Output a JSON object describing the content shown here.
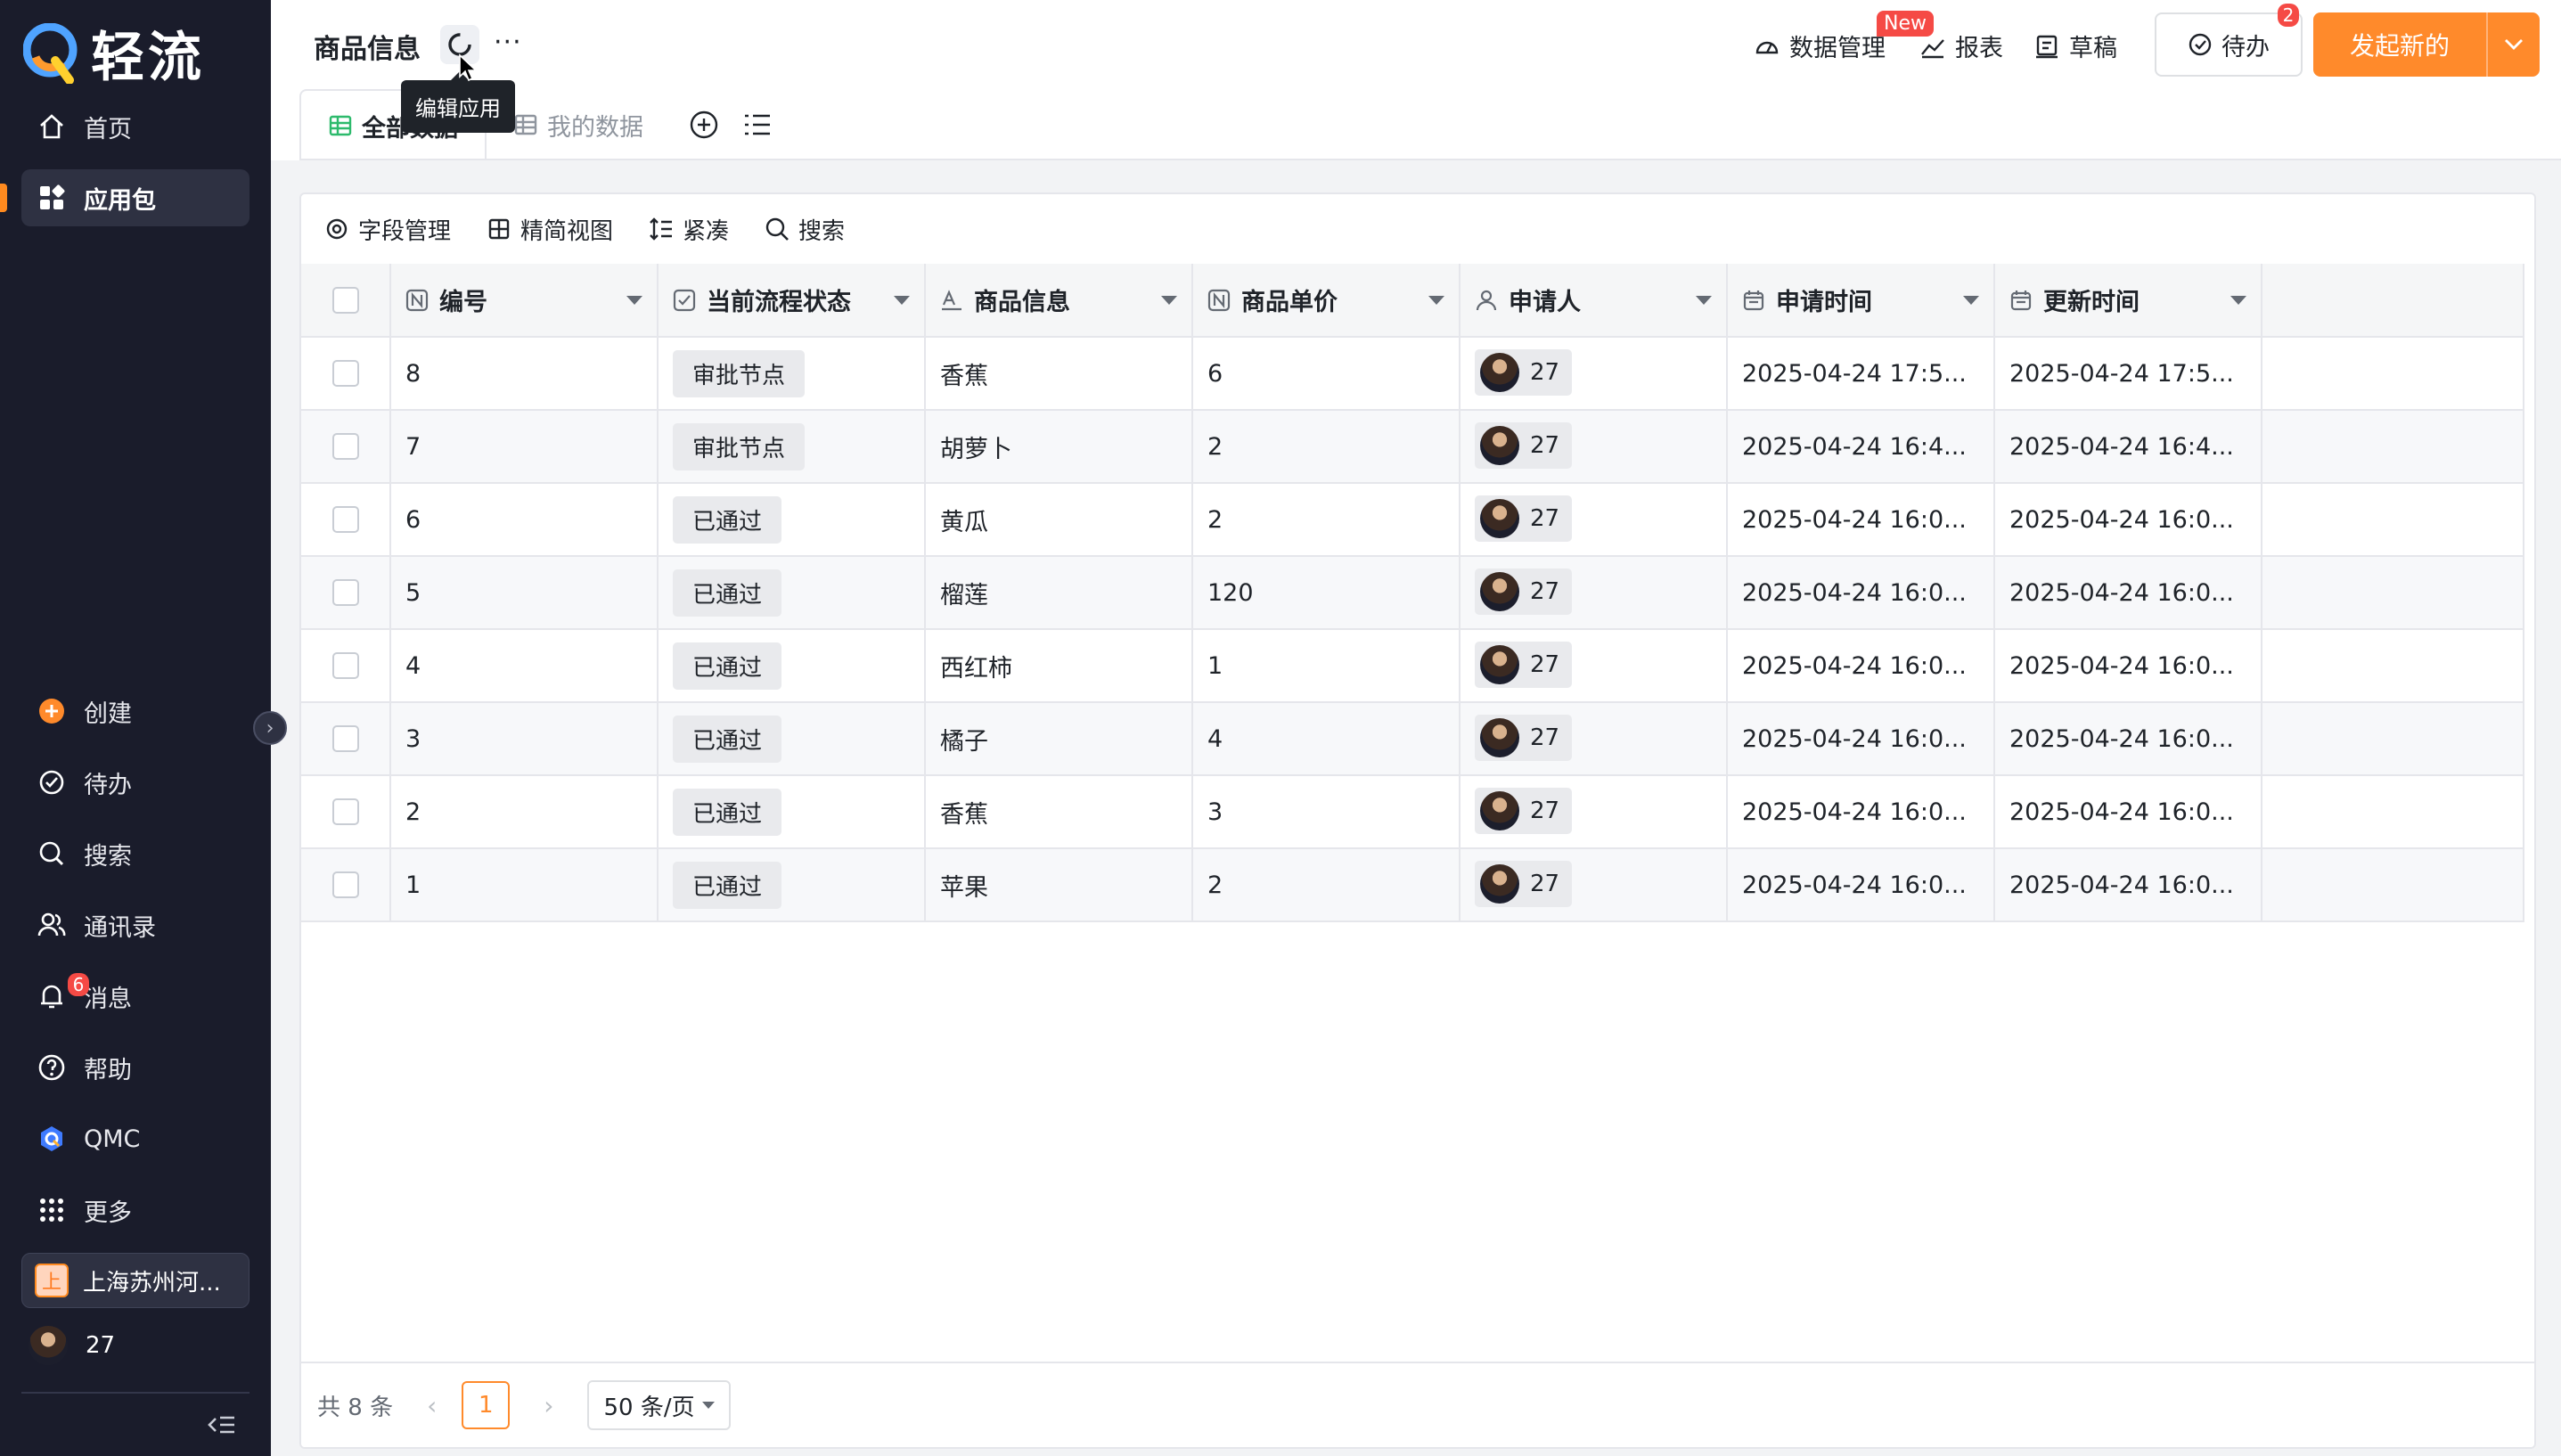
{
  "colors": {
    "sidebar_bg": "#1a1c2b",
    "accent": "#ff8a2b",
    "badge": "#f54a45"
  },
  "app": {
    "brand": "轻流"
  },
  "sidebar": {
    "top_items": [
      {
        "label": "首页",
        "icon": "home-icon"
      },
      {
        "label": "应用包",
        "icon": "apps-icon",
        "active": true
      }
    ],
    "bottom_items": [
      {
        "label": "创建",
        "icon": "plus-circle-icon"
      },
      {
        "label": "待办",
        "icon": "check-circle-icon"
      },
      {
        "label": "搜索",
        "icon": "search-icon"
      },
      {
        "label": "通讯录",
        "icon": "contacts-icon"
      },
      {
        "label": "消息",
        "icon": "bell-icon",
        "badge": "6"
      },
      {
        "label": "帮助",
        "icon": "help-icon"
      },
      {
        "label": "QMC",
        "icon": "qmc-icon"
      },
      {
        "label": "更多",
        "icon": "grid-icon"
      }
    ],
    "org": {
      "initial": "上",
      "name": "上海苏州河..."
    },
    "user": {
      "name": "27"
    }
  },
  "header": {
    "title": "商品信息",
    "tooltip": "编辑应用",
    "more": "···",
    "links": {
      "data_manage": "数据管理",
      "new_badge": "New",
      "report": "报表",
      "draft": "草稿"
    },
    "todo": {
      "label": "待办",
      "badge": "2"
    },
    "start_button": "发起新的",
    "tabs": [
      {
        "label": "全部数据",
        "active": true
      },
      {
        "label": "我的数据",
        "active": false
      }
    ]
  },
  "toolbar": {
    "fields": "字段管理",
    "simple_view": "精简视图",
    "compact": "紧凑",
    "search": "搜索"
  },
  "table": {
    "columns": [
      "编号",
      "当前流程状态",
      "商品信息",
      "商品单价",
      "申请人",
      "申请时间",
      "更新时间"
    ],
    "rows": [
      {
        "id": "8",
        "status": "审批节点",
        "product": "香蕉",
        "price": "6",
        "applicant": "27",
        "applied": "2025-04-24 17:5...",
        "updated": "2025-04-24 17:5..."
      },
      {
        "id": "7",
        "status": "审批节点",
        "product": "胡萝卜",
        "price": "2",
        "applicant": "27",
        "applied": "2025-04-24 16:4...",
        "updated": "2025-04-24 16:4..."
      },
      {
        "id": "6",
        "status": "已通过",
        "product": "黄瓜",
        "price": "2",
        "applicant": "27",
        "applied": "2025-04-24 16:0...",
        "updated": "2025-04-24 16:0..."
      },
      {
        "id": "5",
        "status": "已通过",
        "product": "榴莲",
        "price": "120",
        "applicant": "27",
        "applied": "2025-04-24 16:0...",
        "updated": "2025-04-24 16:0..."
      },
      {
        "id": "4",
        "status": "已通过",
        "product": "西红柿",
        "price": "1",
        "applicant": "27",
        "applied": "2025-04-24 16:0...",
        "updated": "2025-04-24 16:0..."
      },
      {
        "id": "3",
        "status": "已通过",
        "product": "橘子",
        "price": "4",
        "applicant": "27",
        "applied": "2025-04-24 16:0...",
        "updated": "2025-04-24 16:0..."
      },
      {
        "id": "2",
        "status": "已通过",
        "product": "香蕉",
        "price": "3",
        "applicant": "27",
        "applied": "2025-04-24 16:0...",
        "updated": "2025-04-24 16:0..."
      },
      {
        "id": "1",
        "status": "已通过",
        "product": "苹果",
        "price": "2",
        "applicant": "27",
        "applied": "2025-04-24 16:0...",
        "updated": "2025-04-24 16:0..."
      }
    ]
  },
  "pager": {
    "total": "共 8 条",
    "current": "1",
    "size": "50 条/页"
  }
}
